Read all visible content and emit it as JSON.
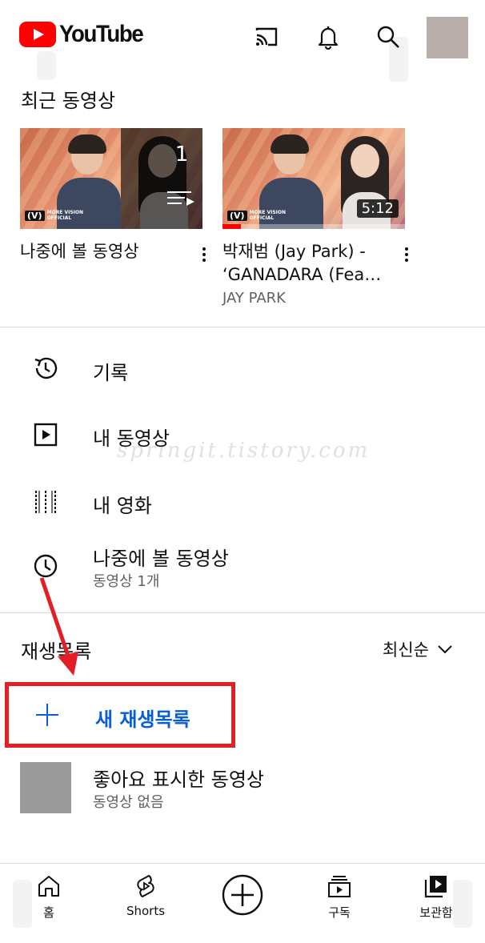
{
  "header": {
    "brand": "YouTube",
    "icons": [
      "cast-icon",
      "bell-icon",
      "search-icon"
    ]
  },
  "recent": {
    "title": "최근 동영상",
    "cards": [
      {
        "title": "나중에 볼 동영상",
        "overlay_count": "1",
        "brand_mark": "(V)",
        "brand_text_1": "MORE VISION",
        "brand_text_2": "OFFICIAL"
      },
      {
        "title": "박재범 (Jay Park) - ‘GANADARA (Fea…",
        "channel": "JAY PARK",
        "duration": "5:12",
        "progress": 0.1,
        "brand_mark": "(V)",
        "brand_text_1": "MORE VISION",
        "brand_text_2": "OFFICIAL"
      }
    ]
  },
  "menu": {
    "items": [
      {
        "label": "기록",
        "icon": "history-icon"
      },
      {
        "label": "내 동영상",
        "icon": "my-videos-icon"
      },
      {
        "label": "내 영화",
        "icon": "movies-icon"
      },
      {
        "label": "나중에 볼 동영상",
        "sub": "동영상 1개",
        "icon": "watch-later-icon"
      }
    ]
  },
  "watermark": "springit.tistory.com",
  "playlists": {
    "title": "재생목록",
    "sort_label": "최신순",
    "new_playlist": "새 재생목록",
    "liked": {
      "title": "좋아요 표시한 동영상",
      "sub": "동영상 없음"
    }
  },
  "bottom_nav": {
    "items": [
      {
        "label": "홈",
        "icon": "home-icon"
      },
      {
        "label": "Shorts",
        "icon": "shorts-icon"
      },
      {
        "label": "",
        "icon": "create-icon"
      },
      {
        "label": "구독",
        "icon": "subscriptions-icon"
      },
      {
        "label": "보관함",
        "icon": "library-icon"
      }
    ]
  },
  "colors": {
    "brand_red": "#ff0000",
    "highlight_red": "#e31e26",
    "link_blue": "#065fd4",
    "secondary_text": "#606060"
  }
}
